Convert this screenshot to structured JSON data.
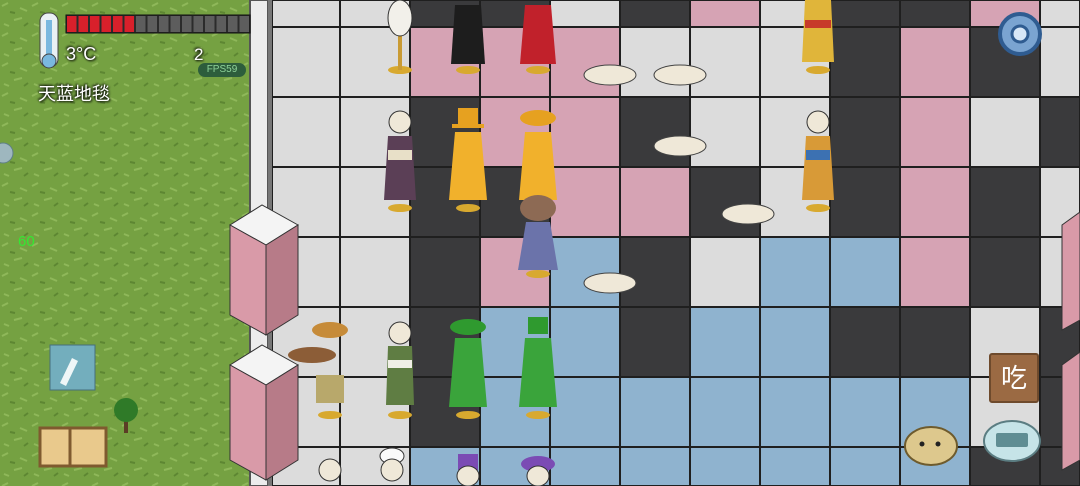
{
  "hud": {
    "temperature": "3°C",
    "carpet_label": "天蓝地毯",
    "count": "2",
    "fps": "FPS59",
    "side_number": "60",
    "eat_button": "吃"
  },
  "icons": {
    "thermometer": "thermometer-icon",
    "health_bar": "health-bar",
    "settings": "gear-icon",
    "pencil": "pencil-icon",
    "book": "book-icon",
    "emote": "potato-emote-icon",
    "keyboard": "keyboard-icon"
  },
  "colors": {
    "grass": "#6f9a3f",
    "tile_white": "#dcdcdc",
    "tile_dark": "#3a3a3c",
    "tile_pink": "#d6a3b4",
    "tile_blue": "#8fb3cf",
    "health_fill": "#d8202b"
  },
  "health": {
    "filled_segments": 6,
    "total_segments": 16
  }
}
